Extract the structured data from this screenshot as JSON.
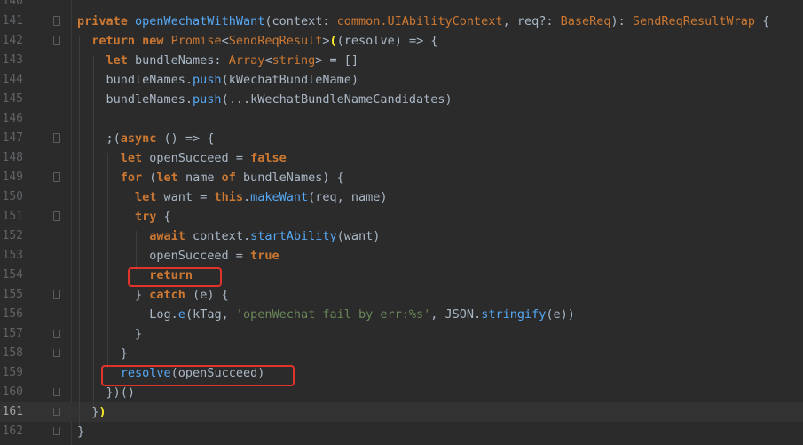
{
  "editor": {
    "current_line": 161,
    "lines": [
      {
        "n": "140",
        "tokens": []
      },
      {
        "n": "141",
        "tokens": [
          {
            "t": "private ",
            "c": "kw"
          },
          {
            "t": "openWechatWithWant",
            "c": "fn"
          },
          {
            "t": "(context: ",
            "c": "id"
          },
          {
            "t": "common.UIAbilityContext",
            "c": "ty"
          },
          {
            "t": ", req?: ",
            "c": "id"
          },
          {
            "t": "BaseReq",
            "c": "ty"
          },
          {
            "t": "): ",
            "c": "id"
          },
          {
            "t": "SendReqResultWrap",
            "c": "ty"
          },
          {
            "t": " {",
            "c": "id"
          }
        ]
      },
      {
        "n": "142",
        "tokens": [
          {
            "t": "  return new ",
            "c": "kw"
          },
          {
            "t": "Promise",
            "c": "ty"
          },
          {
            "t": "<",
            "c": "id"
          },
          {
            "t": "SendReqResult",
            "c": "ty"
          },
          {
            "t": ">",
            "c": "id"
          },
          {
            "t": "(",
            "c": "hl-match"
          },
          {
            "t": "(resolve) => {",
            "c": "id"
          }
        ]
      },
      {
        "n": "143",
        "tokens": [
          {
            "t": "    let ",
            "c": "kw"
          },
          {
            "t": "bundleNames: ",
            "c": "id"
          },
          {
            "t": "Array",
            "c": "ty"
          },
          {
            "t": "<",
            "c": "id"
          },
          {
            "t": "string",
            "c": "ty"
          },
          {
            "t": "> = []",
            "c": "id"
          }
        ]
      },
      {
        "n": "144",
        "tokens": [
          {
            "t": "    bundleNames.",
            "c": "id"
          },
          {
            "t": "push",
            "c": "fn"
          },
          {
            "t": "(kWechatBundleName)",
            "c": "id"
          }
        ]
      },
      {
        "n": "145",
        "tokens": [
          {
            "t": "    bundleNames.",
            "c": "id"
          },
          {
            "t": "push",
            "c": "fn"
          },
          {
            "t": "(...kWechatBundleNameCandidates)",
            "c": "id"
          }
        ]
      },
      {
        "n": "146",
        "tokens": []
      },
      {
        "n": "147",
        "tokens": [
          {
            "t": "    ;(",
            "c": "id"
          },
          {
            "t": "async",
            "c": "kw"
          },
          {
            "t": " () => {",
            "c": "id"
          }
        ]
      },
      {
        "n": "148",
        "tokens": [
          {
            "t": "      let ",
            "c": "kw"
          },
          {
            "t": "openSucceed = ",
            "c": "id"
          },
          {
            "t": "false",
            "c": "kw"
          }
        ]
      },
      {
        "n": "149",
        "tokens": [
          {
            "t": "      for ",
            "c": "kw"
          },
          {
            "t": "(",
            "c": "id"
          },
          {
            "t": "let ",
            "c": "kw"
          },
          {
            "t": "name ",
            "c": "id"
          },
          {
            "t": "of ",
            "c": "kw"
          },
          {
            "t": "bundleNames) {",
            "c": "id"
          }
        ]
      },
      {
        "n": "150",
        "tokens": [
          {
            "t": "        let ",
            "c": "kw"
          },
          {
            "t": "want = ",
            "c": "id"
          },
          {
            "t": "this",
            "c": "kw"
          },
          {
            "t": ".",
            "c": "id"
          },
          {
            "t": "makeWant",
            "c": "fn"
          },
          {
            "t": "(req, name)",
            "c": "id"
          }
        ]
      },
      {
        "n": "151",
        "tokens": [
          {
            "t": "        try ",
            "c": "kw"
          },
          {
            "t": "{",
            "c": "id"
          }
        ]
      },
      {
        "n": "152",
        "tokens": [
          {
            "t": "          await ",
            "c": "kw"
          },
          {
            "t": "context.",
            "c": "id"
          },
          {
            "t": "startAbility",
            "c": "fn"
          },
          {
            "t": "(want)",
            "c": "id"
          }
        ]
      },
      {
        "n": "153",
        "tokens": [
          {
            "t": "          openSucceed = ",
            "c": "id"
          },
          {
            "t": "true",
            "c": "kw"
          }
        ]
      },
      {
        "n": "154",
        "tokens": [
          {
            "t": "          return",
            "c": "kw"
          }
        ]
      },
      {
        "n": "155",
        "tokens": [
          {
            "t": "        } ",
            "c": "id"
          },
          {
            "t": "catch ",
            "c": "kw"
          },
          {
            "t": "(e) {",
            "c": "id"
          }
        ]
      },
      {
        "n": "156",
        "tokens": [
          {
            "t": "          Log.",
            "c": "id"
          },
          {
            "t": "e",
            "c": "fn"
          },
          {
            "t": "(kTag, ",
            "c": "id"
          },
          {
            "t": "'openWechat fail by err:%s'",
            "c": "str"
          },
          {
            "t": ", JSON.",
            "c": "id"
          },
          {
            "t": "stringify",
            "c": "fn"
          },
          {
            "t": "(e))",
            "c": "id"
          }
        ]
      },
      {
        "n": "157",
        "tokens": [
          {
            "t": "        }",
            "c": "id"
          }
        ]
      },
      {
        "n": "158",
        "tokens": [
          {
            "t": "      }",
            "c": "id"
          }
        ]
      },
      {
        "n": "159",
        "tokens": [
          {
            "t": "      resolve",
            "c": "fn"
          },
          {
            "t": "(openSucceed)",
            "c": "id"
          }
        ]
      },
      {
        "n": "160",
        "tokens": [
          {
            "t": "    })()",
            "c": "id"
          }
        ]
      },
      {
        "n": "161",
        "tokens": [
          {
            "t": "  }",
            "c": "id"
          },
          {
            "t": ")",
            "c": "hl-match"
          }
        ]
      },
      {
        "n": "162",
        "tokens": [
          {
            "t": "}",
            "c": "id"
          }
        ]
      }
    ]
  },
  "annotations": {
    "count": 2,
    "color": "#e0342a",
    "highlighted_code": [
      "return",
      "resolve(openSucceed)"
    ]
  },
  "colors": {
    "background": "#2b2b2b",
    "keyword": "#cc7832",
    "function": "#56a8f5",
    "string": "#6a8759",
    "identifier": "#a9b7c6",
    "annotation": "#e0342a"
  }
}
